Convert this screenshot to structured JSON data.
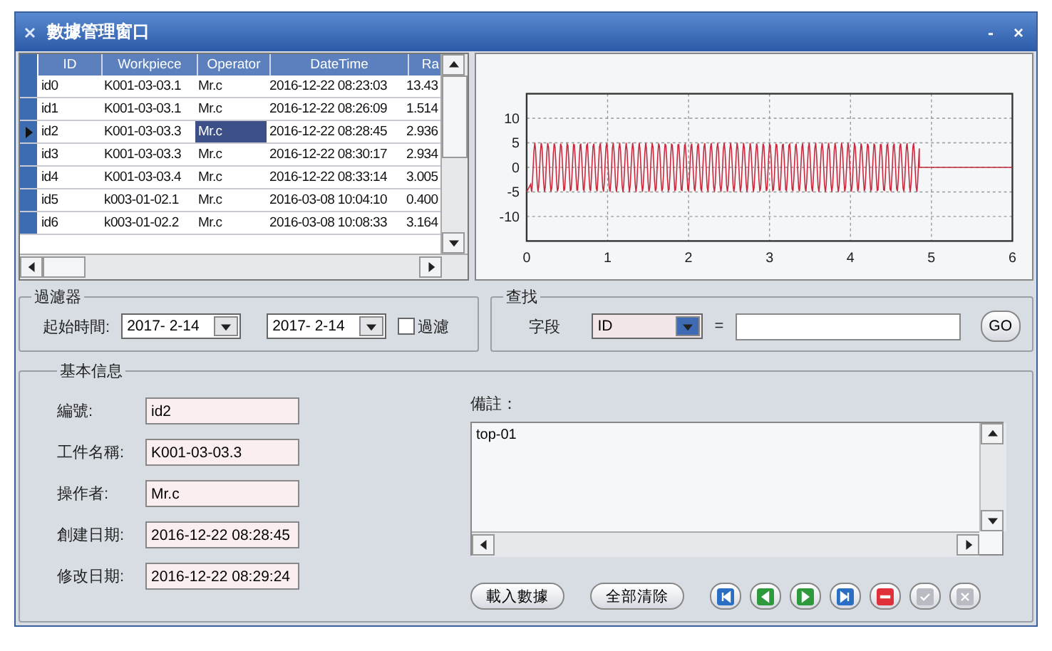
{
  "window": {
    "title": "數據管理窗口",
    "controls": [
      "-",
      "×"
    ]
  },
  "grid": {
    "columns": [
      "ID",
      "Workpiece",
      "Operator",
      "DateTime",
      "Ra"
    ],
    "rows": [
      {
        "selected": false,
        "cells": [
          {
            "text": "id0",
            "focused": false
          },
          {
            "text": "K001-03-03.1",
            "focused": false
          },
          {
            "text": "Mr.c",
            "focused": false
          },
          {
            "text": "2016-12-22 08:23:03",
            "focused": false
          },
          {
            "text": "13.43",
            "focused": false
          }
        ]
      },
      {
        "selected": false,
        "cells": [
          {
            "text": "id1",
            "focused": false
          },
          {
            "text": "K001-03-03.1",
            "focused": false
          },
          {
            "text": "Mr.c",
            "focused": false
          },
          {
            "text": "2016-12-22 08:26:09",
            "focused": false
          },
          {
            "text": "1.514",
            "focused": false
          }
        ]
      },
      {
        "selected": true,
        "cells": [
          {
            "text": "id2",
            "focused": false
          },
          {
            "text": "K001-03-03.3",
            "focused": false
          },
          {
            "text": "Mr.c",
            "focused": true
          },
          {
            "text": "2016-12-22 08:28:45",
            "focused": false
          },
          {
            "text": "2.936",
            "focused": false
          }
        ]
      },
      {
        "selected": false,
        "cells": [
          {
            "text": "id3",
            "focused": false
          },
          {
            "text": "K001-03-03.3",
            "focused": false
          },
          {
            "text": "Mr.c",
            "focused": false
          },
          {
            "text": "2016-12-22 08:30:17",
            "focused": false
          },
          {
            "text": "2.934",
            "focused": false
          }
        ]
      },
      {
        "selected": false,
        "cells": [
          {
            "text": "id4",
            "focused": false
          },
          {
            "text": "K001-03-03.4",
            "focused": false
          },
          {
            "text": "Mr.c",
            "focused": false
          },
          {
            "text": "2016-12-22 08:33:14",
            "focused": false
          },
          {
            "text": "3.005",
            "focused": false
          }
        ]
      },
      {
        "selected": false,
        "cells": [
          {
            "text": "id5",
            "focused": false
          },
          {
            "text": "k003-01-02.1",
            "focused": false
          },
          {
            "text": "Mr.c",
            "focused": false
          },
          {
            "text": "2016-03-08 10:04:10",
            "focused": false
          },
          {
            "text": "0.400",
            "focused": false
          }
        ]
      },
      {
        "selected": false,
        "cells": [
          {
            "text": "id6",
            "focused": false
          },
          {
            "text": "k003-01-02.2",
            "focused": false
          },
          {
            "text": "Mr.c",
            "focused": false
          },
          {
            "text": "2016-03-08 10:08:33",
            "focused": false
          },
          {
            "text": "3.164",
            "focused": false
          }
        ]
      }
    ]
  },
  "plot": {
    "yticks": [
      "10",
      "5",
      "0",
      "-5",
      "-10"
    ],
    "xticks": [
      "0",
      "1",
      "2",
      "3",
      "4",
      "5",
      "6"
    ]
  },
  "filter": {
    "title": "過濾器",
    "label": "起始時間:",
    "from": "2017- 2-14",
    "to": "2017- 2-14",
    "checkbox": {
      "label": "過濾",
      "checked": false
    }
  },
  "search": {
    "title": "查找",
    "label": "字段",
    "field": "ID",
    "operator": "=",
    "button": "GO"
  },
  "info": {
    "title": "基本信息",
    "fields": [
      {
        "label": "編號:",
        "value": "id2"
      },
      {
        "label": "工件名稱:",
        "value": "K001-03-03.3"
      },
      {
        "label": "操作者:",
        "value": "Mr.c"
      },
      {
        "label": "創建日期:",
        "value": "2016-12-22 08:28:45"
      },
      {
        "label": "修改日期:",
        "value": "2016-12-22 08:29:24"
      }
    ],
    "remarks": {
      "label": "備註：",
      "value": "top-01"
    }
  },
  "buttons": [
    "載入數據",
    "全部清除"
  ],
  "nav_buttons": [
    {
      "kind": "first",
      "disabled": false
    },
    {
      "kind": "prev",
      "disabled": false
    },
    {
      "kind": "next",
      "disabled": false
    },
    {
      "kind": "last",
      "disabled": false
    },
    {
      "kind": "delete",
      "disabled": false
    },
    {
      "kind": "confirm",
      "disabled": true
    },
    {
      "kind": "cancel",
      "disabled": true
    }
  ]
}
